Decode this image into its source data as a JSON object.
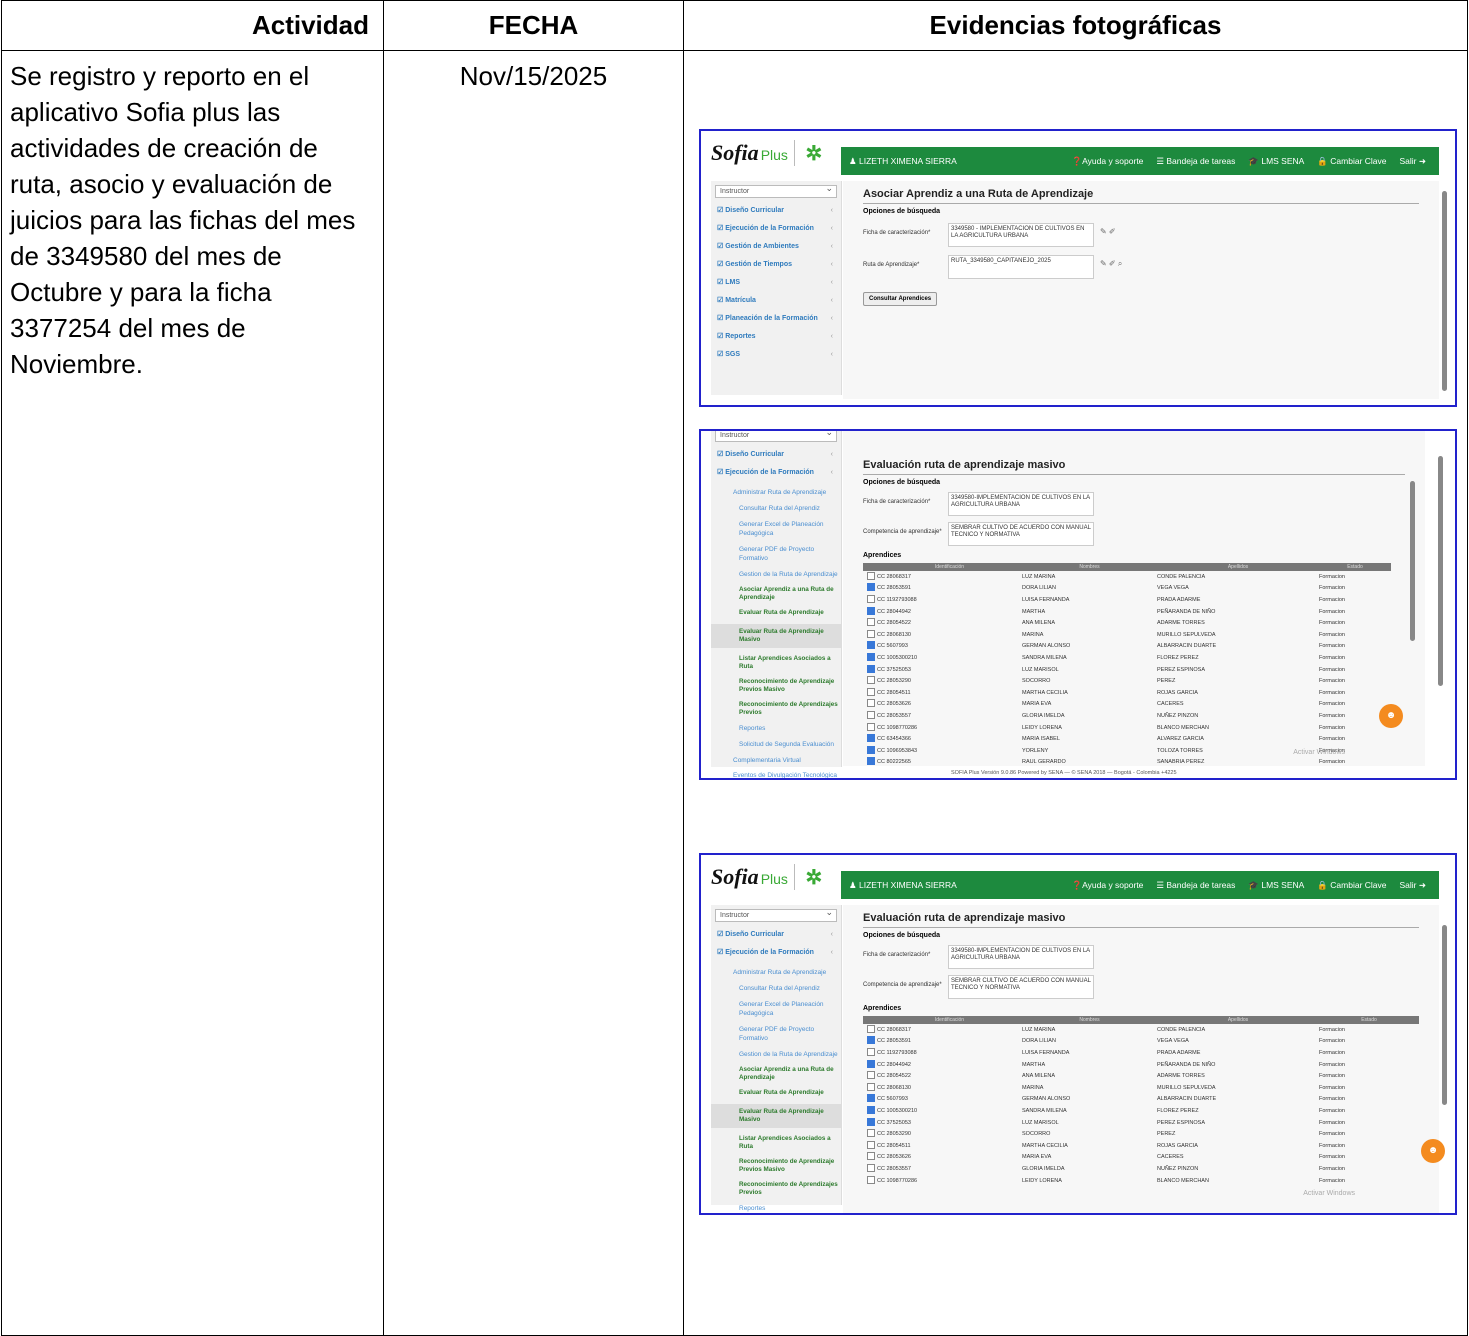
{
  "table": {
    "headers": {
      "actividad": "Actividad",
      "fecha": "FECHA",
      "evidencias": "Evidencias fotográficas"
    },
    "row": {
      "actividad": "Se registro y reporto en el aplicativo Sofia plus las actividades de creación de ruta, asocio y evaluación de juicios para las fichas del mes de 3349580 del mes de Octubre y para la ficha 3377254 del mes de Noviembre.",
      "fecha": "Nov/15/2025"
    }
  },
  "app": {
    "logo": "Sofia",
    "logo_suffix": "Plus",
    "user": "♟ LIZETH XIMENA SIERRA",
    "menu": [
      "❓Ayuda y soporte",
      "☰ Bandeja de tareas",
      "🎓 LMS SENA",
      "🔒 Cambiar Clave",
      "Salir ➜"
    ],
    "role": "Instructor",
    "sidebar_main": [
      "☑ Diseño Curricular",
      "☑ Ejecución de la Formación",
      "☑ Gestión de Ambientes",
      "☑ Gestión de Tiempos",
      "☑ LMS",
      "☑ Matrícula",
      "☑ Planeación de la Formación",
      "☑ Reportes",
      "☑ SGS"
    ],
    "sidebar_expanded": {
      "diseno": "☑ Diseño Curricular",
      "ejecucion": "☑ Ejecución de la Formación",
      "admin_ruta": "Administrar Ruta de Aprendizaje",
      "consultar_ruta": "Consultar Ruta del Aprendiz",
      "generar_excel": "Generar Excel de Planeación Pedagógica",
      "generar_pdf": "Generar PDF de Proyecto Formativo",
      "gestion_ruta": "Gestion de la Ruta de Aprendizaje",
      "asociar": "Asociar Aprendiz a una Ruta de Aprendizaje",
      "evaluar": "Evaluar Ruta de Aprendizaje",
      "evaluar_masivo": "Evaluar Ruta de Aprendizaje Masivo",
      "listar": "Listar Aprendices Asociados a Ruta",
      "reconocimiento_masivo": "Reconocimiento de Aprendizaje Previos Masivo",
      "reconocimiento": "Reconocimiento de Aprendizajes Previos",
      "reportes": "Reportes",
      "solicitud": "Solicitud de Segunda Evaluación",
      "complementaria": "Complementaria Virtual",
      "eventos": "Eventos de Divulgación Tecnológica"
    },
    "screen1": {
      "title": "Asociar Aprendiz a una Ruta de Aprendizaje",
      "subtitle": "Opciones de búsqueda",
      "ficha_label": "Ficha de caracterización*",
      "ficha_value": "3349580 - IMPLEMENTACION DE CULTIVOS EN LA AGRICULTURA URBANA",
      "ruta_label": "Ruta de Aprendizaje*",
      "ruta_value": "RUTA_3349580_CAPITANEJO_2025",
      "button": "Consultar Aprendices"
    },
    "screen2": {
      "title": "Evaluación ruta de aprendizaje masivo",
      "subtitle": "Opciones de búsqueda",
      "ficha_label": "Ficha de caracterización*",
      "ficha_value": "3349580-IMPLEMENTACION DE CULTIVOS EN LA AGRICULTURA URBANA",
      "competencia_label": "Competencia de aprendizaje*",
      "competencia_value": "SEMBRAR CULTIVO DE ACUERDO CON MANUAL TECNICO Y NORMATIVA",
      "aprendices": "Aprendices",
      "columns": [
        "",
        "Identificación",
        "Nombres",
        "Apellidos",
        "Estado"
      ],
      "footer": "SOFIA Plus Versión 9.0.86 Powered by SENA — © SENA 2018 — Bogotá - Colombia +4225",
      "watermark": "Activar Windows"
    },
    "aprendices": [
      {
        "on": false,
        "id": "CC 28068317",
        "nombres": "LUZ MARINA",
        "apellidos": "CONDE PALENCIA",
        "estado": "Formacion"
      },
      {
        "on": true,
        "id": "CC 28053591",
        "nombres": "DORA LILIAN",
        "apellidos": "VEGA VEGA",
        "estado": "Formacion"
      },
      {
        "on": false,
        "id": "CC 1192793088",
        "nombres": "LUISA FERNANDA",
        "apellidos": "PRADA ADARME",
        "estado": "Formacion"
      },
      {
        "on": true,
        "id": "CC 28044942",
        "nombres": "MARTHA",
        "apellidos": "PEÑARANDA DE NIÑO",
        "estado": "Formacion"
      },
      {
        "on": false,
        "id": "CC 28054522",
        "nombres": "ANA MILENA",
        "apellidos": "ADARME TORRES",
        "estado": "Formacion"
      },
      {
        "on": false,
        "id": "CC 28068130",
        "nombres": "MARINA",
        "apellidos": "MURILLO SEPULVEDA",
        "estado": "Formacion"
      },
      {
        "on": true,
        "id": "CC 5607993",
        "nombres": "GERMAN ALONSO",
        "apellidos": "ALBARRACIN DUARTE",
        "estado": "Formacion"
      },
      {
        "on": true,
        "id": "CC 1005300210",
        "nombres": "SANDRA MILENA",
        "apellidos": "FLOREZ PEREZ",
        "estado": "Formacion"
      },
      {
        "on": true,
        "id": "CC 37525053",
        "nombres": "LUZ MARISOL",
        "apellidos": "PEREZ ESPINOSA",
        "estado": "Formacion"
      },
      {
        "on": false,
        "id": "CC 28053290",
        "nombres": "SOCORRO",
        "apellidos": "PEREZ",
        "estado": "Formacion"
      },
      {
        "on": false,
        "id": "CC 28054511",
        "nombres": "MARTHA CECILIA",
        "apellidos": "ROJAS GARCIA",
        "estado": "Formacion"
      },
      {
        "on": false,
        "id": "CC 28053626",
        "nombres": "MARIA EVA",
        "apellidos": "CACERES",
        "estado": "Formacion"
      },
      {
        "on": false,
        "id": "CC 28053557",
        "nombres": "GLORIA IMELDA",
        "apellidos": "NUÑEZ PINZON",
        "estado": "Formacion"
      },
      {
        "on": false,
        "id": "CC 1098770286",
        "nombres": "LEIDY LORENA",
        "apellidos": "BLANCO MERCHAN",
        "estado": "Formacion"
      },
      {
        "on": true,
        "id": "CC 63454366",
        "nombres": "MARIA ISABEL",
        "apellidos": "ALVAREZ GARCIA",
        "estado": "Formacion"
      },
      {
        "on": true,
        "id": "CC 1096953843",
        "nombres": "YORLENY",
        "apellidos": "TOLOZA TORRES",
        "estado": "Formacion"
      },
      {
        "on": true,
        "id": "CC 80222565",
        "nombres": "RAUL GERARDO",
        "apellidos": "SANABRIA PEREZ",
        "estado": "Formacion"
      }
    ]
  }
}
